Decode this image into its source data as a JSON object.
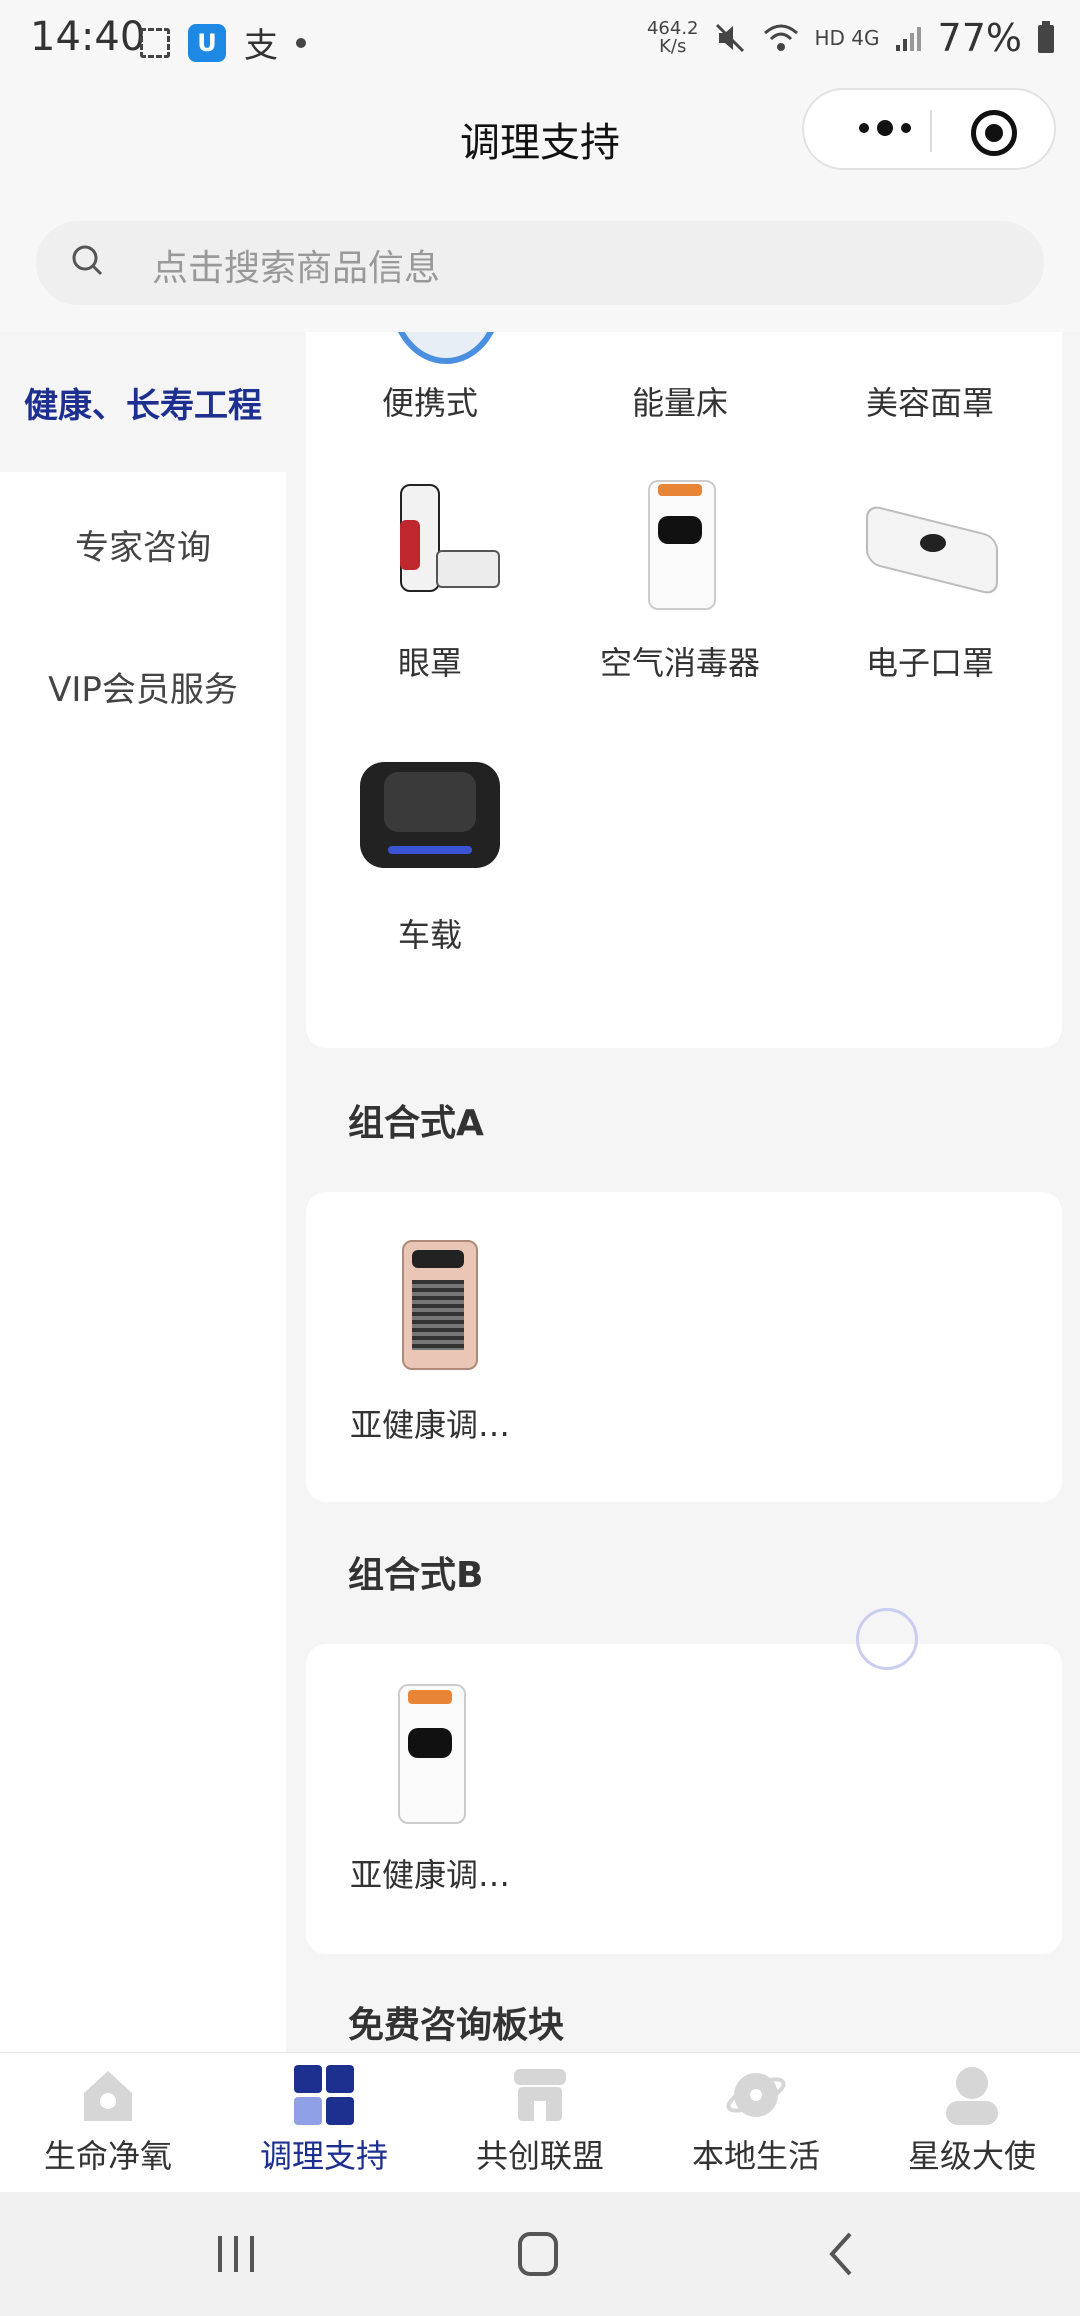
{
  "status_bar": {
    "time": "14:40",
    "net_speed_value": "464.2",
    "net_speed_unit": "K/s",
    "signal_labels": "HD 4G",
    "battery": "77%"
  },
  "header": {
    "title": "调理支持"
  },
  "search": {
    "placeholder": "点击搜索商品信息"
  },
  "sidebar": {
    "items": [
      {
        "label": "健康、长寿工程",
        "active": true
      },
      {
        "label": "专家咨询",
        "active": false
      },
      {
        "label": "VIP会员服务",
        "active": false
      }
    ]
  },
  "content": {
    "top_products": [
      {
        "name": "便携式"
      },
      {
        "name": "能量床"
      },
      {
        "name": "美容面罩"
      },
      {
        "name": "眼罩"
      },
      {
        "name": "空气消毒器"
      },
      {
        "name": "电子口罩"
      },
      {
        "name": "车载"
      }
    ],
    "sections": [
      {
        "title": "组合式A",
        "products": [
          {
            "name": "亚健康调…"
          }
        ]
      },
      {
        "title": "组合式B",
        "products": [
          {
            "name": "亚健康调…"
          }
        ]
      },
      {
        "title": "免费咨询板块"
      }
    ]
  },
  "tabbar": {
    "tabs": [
      {
        "label": "生命净氧",
        "icon": "home-icon",
        "active": false
      },
      {
        "label": "调理支持",
        "icon": "grid-icon",
        "active": true
      },
      {
        "label": "共创联盟",
        "icon": "store-icon",
        "active": false
      },
      {
        "label": "本地生活",
        "icon": "planet-icon",
        "active": false
      },
      {
        "label": "星级大使",
        "icon": "person-icon",
        "active": false
      }
    ]
  },
  "colors": {
    "accent": "#1d2f8f",
    "background": "#f5f5f5"
  }
}
